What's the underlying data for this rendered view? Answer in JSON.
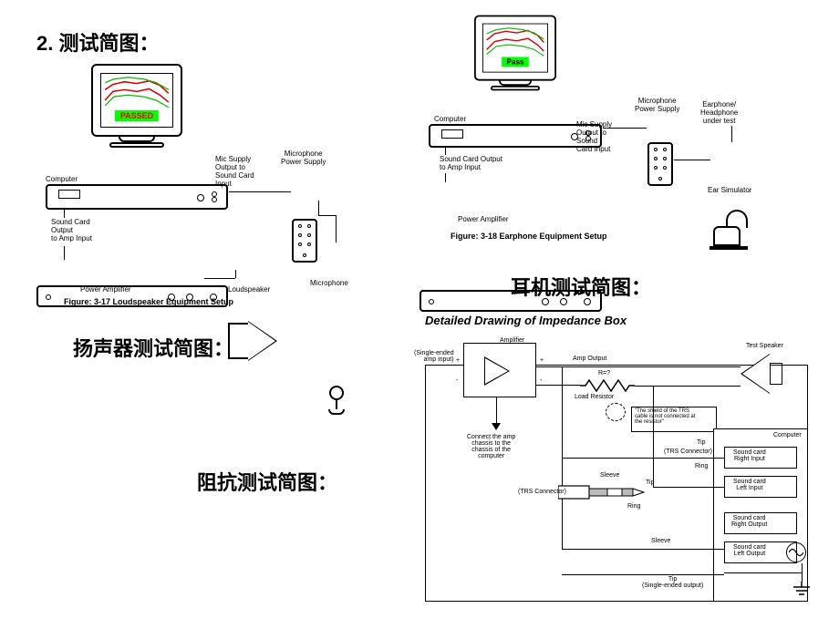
{
  "headings": {
    "main": "2. 测试简图：",
    "loudspeaker_cn": "扬声器测试简图：",
    "earphone_cn": "耳机测试简图：",
    "impedance_cn": "阻抗测试简图：",
    "impedance_title": "Detailed Drawing of Impedance Box"
  },
  "loudspeaker": {
    "pass_label": "PASSED",
    "computer": "Computer",
    "mic_supply": "Mic Supply\nOutput to\nSound Card\nInput",
    "mic_psu": "Microphone\nPower Supply",
    "soundcard_out": "Sound Card\nOutput\nto Amp Input",
    "power_amp": "Power Amplifier",
    "loudspeaker_label": "Loudspeaker",
    "microphone": "Microphone",
    "caption": "Figure:  3-17  Loudspeaker Equipment Setup"
  },
  "earphone": {
    "pass_label": "Pass",
    "computer": "Computer",
    "mic_supply": "Mic Supply\nOutput to\nSound\nCard Input",
    "mic_psu": "Microphone\nPower Supply",
    "soundcard_out": "Sound Card Output\nto Amp Input",
    "power_amp": "Power Amplifier",
    "ear_sim": "Ear Simulator",
    "earphone_under_test": "Earphone/\nHeadphone\nunder test",
    "caption": "Figure:  3-18  Earphone Equipment Setup"
  },
  "impedance": {
    "single_ended_in": "(Single-ended\namp input)",
    "amplifier": "Amplifier",
    "amp_output": "Amp Output",
    "r_label": "R=?",
    "load_resistor": "Load Resistor",
    "test_speaker": "Test Speaker",
    "shield_note": "\"The shield of the TRS\ncable is not connected at\nthe resistor\"",
    "connect_chassis": "Connect the amp\nchassis to the\nchassis of the\ncomputer",
    "tip": "Tip",
    "ring": "Ring",
    "sleeve": "Sleeve",
    "trs_connector": "(TRS Connector)",
    "computer": "Computer",
    "sc_right_in": "Sound card\nRight Input",
    "sc_left_in": "Sound card\nLeft Input",
    "sc_right_out": "Sound card\nRight Output",
    "sc_left_out": "Sound card\nLeft Output",
    "single_ended_out": "Tip\n(Single-ended output)",
    "plus": "+",
    "minus": "-"
  }
}
